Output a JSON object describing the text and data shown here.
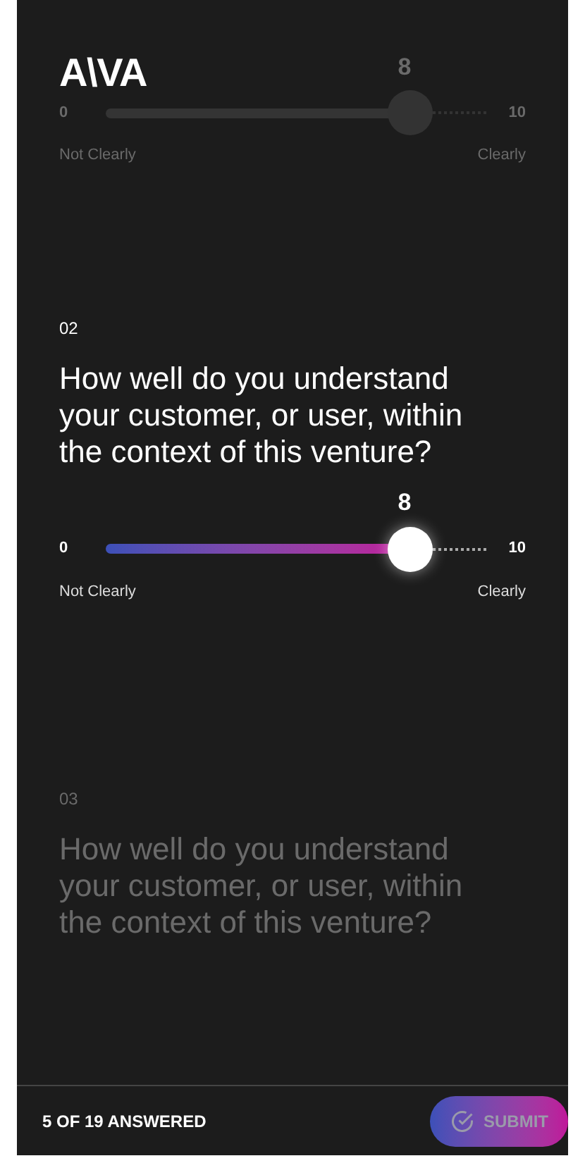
{
  "logo": "A\\VA",
  "questions": [
    {
      "active": false,
      "slider": {
        "value": "8",
        "min": "0",
        "max": "10",
        "min_label": "Not Clearly",
        "max_label": "Clearly",
        "level": 0.8
      }
    },
    {
      "active": true,
      "number": "02",
      "text": "How well do you understand your customer, or user, within the context of this venture?",
      "slider": {
        "value": "8",
        "min": "0",
        "max": "10",
        "min_label": "Not Clearly",
        "max_label": "Clearly",
        "level": 0.8
      }
    },
    {
      "active": false,
      "number": "03",
      "text": "How well do you understand your customer, or user, within the context of this venture?"
    }
  ],
  "footer": {
    "progress": "5 OF 19 ANSWERED",
    "submit": {
      "label": "SUBMIT",
      "disabled": true
    }
  }
}
